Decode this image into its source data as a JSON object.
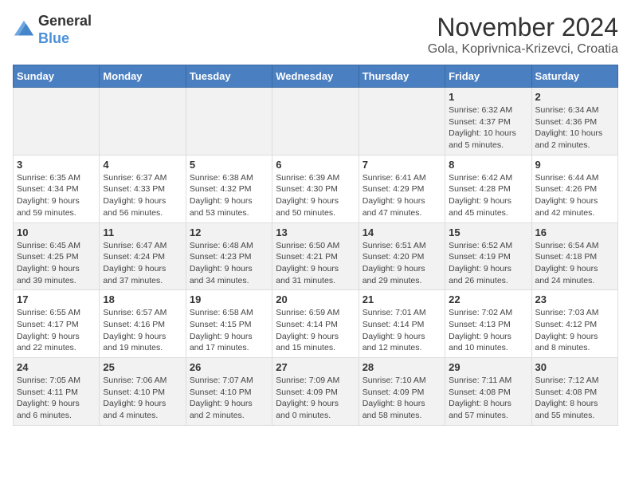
{
  "header": {
    "logo_general": "General",
    "logo_blue": "Blue",
    "month_title": "November 2024",
    "location": "Gola, Koprivnica-Krizevci, Croatia"
  },
  "weekdays": [
    "Sunday",
    "Monday",
    "Tuesday",
    "Wednesday",
    "Thursday",
    "Friday",
    "Saturday"
  ],
  "weeks": [
    [
      {
        "day": "",
        "info": ""
      },
      {
        "day": "",
        "info": ""
      },
      {
        "day": "",
        "info": ""
      },
      {
        "day": "",
        "info": ""
      },
      {
        "day": "",
        "info": ""
      },
      {
        "day": "1",
        "info": "Sunrise: 6:32 AM\nSunset: 4:37 PM\nDaylight: 10 hours\nand 5 minutes."
      },
      {
        "day": "2",
        "info": "Sunrise: 6:34 AM\nSunset: 4:36 PM\nDaylight: 10 hours\nand 2 minutes."
      }
    ],
    [
      {
        "day": "3",
        "info": "Sunrise: 6:35 AM\nSunset: 4:34 PM\nDaylight: 9 hours\nand 59 minutes."
      },
      {
        "day": "4",
        "info": "Sunrise: 6:37 AM\nSunset: 4:33 PM\nDaylight: 9 hours\nand 56 minutes."
      },
      {
        "day": "5",
        "info": "Sunrise: 6:38 AM\nSunset: 4:32 PM\nDaylight: 9 hours\nand 53 minutes."
      },
      {
        "day": "6",
        "info": "Sunrise: 6:39 AM\nSunset: 4:30 PM\nDaylight: 9 hours\nand 50 minutes."
      },
      {
        "day": "7",
        "info": "Sunrise: 6:41 AM\nSunset: 4:29 PM\nDaylight: 9 hours\nand 47 minutes."
      },
      {
        "day": "8",
        "info": "Sunrise: 6:42 AM\nSunset: 4:28 PM\nDaylight: 9 hours\nand 45 minutes."
      },
      {
        "day": "9",
        "info": "Sunrise: 6:44 AM\nSunset: 4:26 PM\nDaylight: 9 hours\nand 42 minutes."
      }
    ],
    [
      {
        "day": "10",
        "info": "Sunrise: 6:45 AM\nSunset: 4:25 PM\nDaylight: 9 hours\nand 39 minutes."
      },
      {
        "day": "11",
        "info": "Sunrise: 6:47 AM\nSunset: 4:24 PM\nDaylight: 9 hours\nand 37 minutes."
      },
      {
        "day": "12",
        "info": "Sunrise: 6:48 AM\nSunset: 4:23 PM\nDaylight: 9 hours\nand 34 minutes."
      },
      {
        "day": "13",
        "info": "Sunrise: 6:50 AM\nSunset: 4:21 PM\nDaylight: 9 hours\nand 31 minutes."
      },
      {
        "day": "14",
        "info": "Sunrise: 6:51 AM\nSunset: 4:20 PM\nDaylight: 9 hours\nand 29 minutes."
      },
      {
        "day": "15",
        "info": "Sunrise: 6:52 AM\nSunset: 4:19 PM\nDaylight: 9 hours\nand 26 minutes."
      },
      {
        "day": "16",
        "info": "Sunrise: 6:54 AM\nSunset: 4:18 PM\nDaylight: 9 hours\nand 24 minutes."
      }
    ],
    [
      {
        "day": "17",
        "info": "Sunrise: 6:55 AM\nSunset: 4:17 PM\nDaylight: 9 hours\nand 22 minutes."
      },
      {
        "day": "18",
        "info": "Sunrise: 6:57 AM\nSunset: 4:16 PM\nDaylight: 9 hours\nand 19 minutes."
      },
      {
        "day": "19",
        "info": "Sunrise: 6:58 AM\nSunset: 4:15 PM\nDaylight: 9 hours\nand 17 minutes."
      },
      {
        "day": "20",
        "info": "Sunrise: 6:59 AM\nSunset: 4:14 PM\nDaylight: 9 hours\nand 15 minutes."
      },
      {
        "day": "21",
        "info": "Sunrise: 7:01 AM\nSunset: 4:14 PM\nDaylight: 9 hours\nand 12 minutes."
      },
      {
        "day": "22",
        "info": "Sunrise: 7:02 AM\nSunset: 4:13 PM\nDaylight: 9 hours\nand 10 minutes."
      },
      {
        "day": "23",
        "info": "Sunrise: 7:03 AM\nSunset: 4:12 PM\nDaylight: 9 hours\nand 8 minutes."
      }
    ],
    [
      {
        "day": "24",
        "info": "Sunrise: 7:05 AM\nSunset: 4:11 PM\nDaylight: 9 hours\nand 6 minutes."
      },
      {
        "day": "25",
        "info": "Sunrise: 7:06 AM\nSunset: 4:10 PM\nDaylight: 9 hours\nand 4 minutes."
      },
      {
        "day": "26",
        "info": "Sunrise: 7:07 AM\nSunset: 4:10 PM\nDaylight: 9 hours\nand 2 minutes."
      },
      {
        "day": "27",
        "info": "Sunrise: 7:09 AM\nSunset: 4:09 PM\nDaylight: 9 hours\nand 0 minutes."
      },
      {
        "day": "28",
        "info": "Sunrise: 7:10 AM\nSunset: 4:09 PM\nDaylight: 8 hours\nand 58 minutes."
      },
      {
        "day": "29",
        "info": "Sunrise: 7:11 AM\nSunset: 4:08 PM\nDaylight: 8 hours\nand 57 minutes."
      },
      {
        "day": "30",
        "info": "Sunrise: 7:12 AM\nSunset: 4:08 PM\nDaylight: 8 hours\nand 55 minutes."
      }
    ]
  ]
}
